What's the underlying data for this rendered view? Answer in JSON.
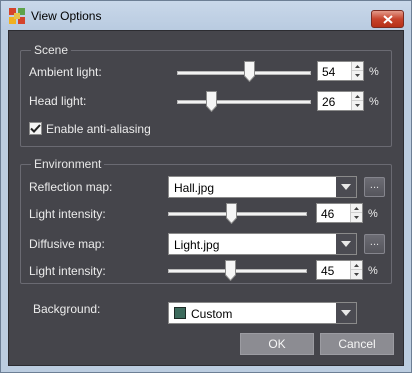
{
  "window": {
    "title": "View Options",
    "accent": "#c7442d"
  },
  "scene": {
    "title": "Scene",
    "ambient": {
      "label": "Ambient light:",
      "value": "54",
      "level": 54,
      "unit": "%"
    },
    "head": {
      "label": "Head light:",
      "value": "26",
      "level": 26,
      "unit": "%"
    },
    "antialias": {
      "label": "Enable anti-aliasing",
      "checked": true
    }
  },
  "environment": {
    "title": "Environment",
    "reflection": {
      "label": "Reflection map:",
      "value": "Hall.jpg",
      "browse": "..."
    },
    "reflection_intensity": {
      "label": "Light intensity:",
      "value": "46",
      "level": 46,
      "unit": "%"
    },
    "diffusive": {
      "label": "Diffusive map:",
      "value": "Light.jpg",
      "browse": "..."
    },
    "diffusive_intensity": {
      "label": "Light intensity:",
      "value": "45",
      "level": 45,
      "unit": "%"
    }
  },
  "background": {
    "label": "Background:",
    "value": "Custom",
    "swatch_color": "#3d6b5d"
  },
  "buttons": {
    "ok": "OK",
    "cancel": "Cancel"
  }
}
